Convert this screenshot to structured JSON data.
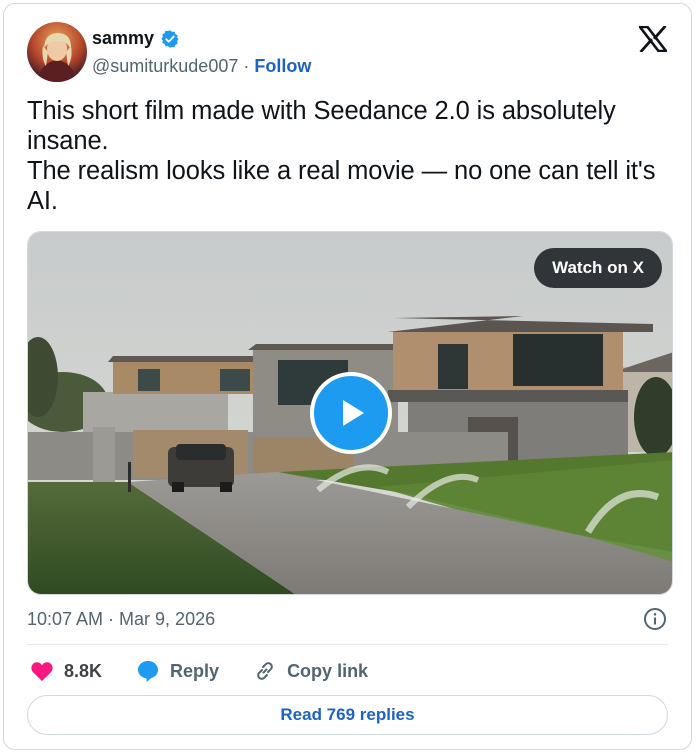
{
  "author": {
    "display_name": "sammy",
    "handle": "@sumiturkude007",
    "separator": "·",
    "follow_label": "Follow"
  },
  "tweet": {
    "lines": [
      "This short film made with Seedance 2.0 is absolutely",
      "insane.",
      "The realism looks like a real movie — no one can tell it's",
      "AI."
    ]
  },
  "media": {
    "watch_label": "Watch on X"
  },
  "meta": {
    "timestamp": "10:07 AM · Mar 9, 2026"
  },
  "actions": {
    "likes": "8.8K",
    "reply_label": "Reply",
    "copy_label": "Copy link",
    "read_replies_label": "Read 769 replies"
  },
  "colors": {
    "link_blue": "#1d63c3",
    "verified_blue": "#1d9bf0",
    "like_pink": "#f91880",
    "muted": "#536471"
  },
  "icons": [
    "verified-badge-icon",
    "x-logo-icon",
    "play-icon",
    "info-icon",
    "heart-icon",
    "reply-bubble-icon",
    "link-icon"
  ]
}
